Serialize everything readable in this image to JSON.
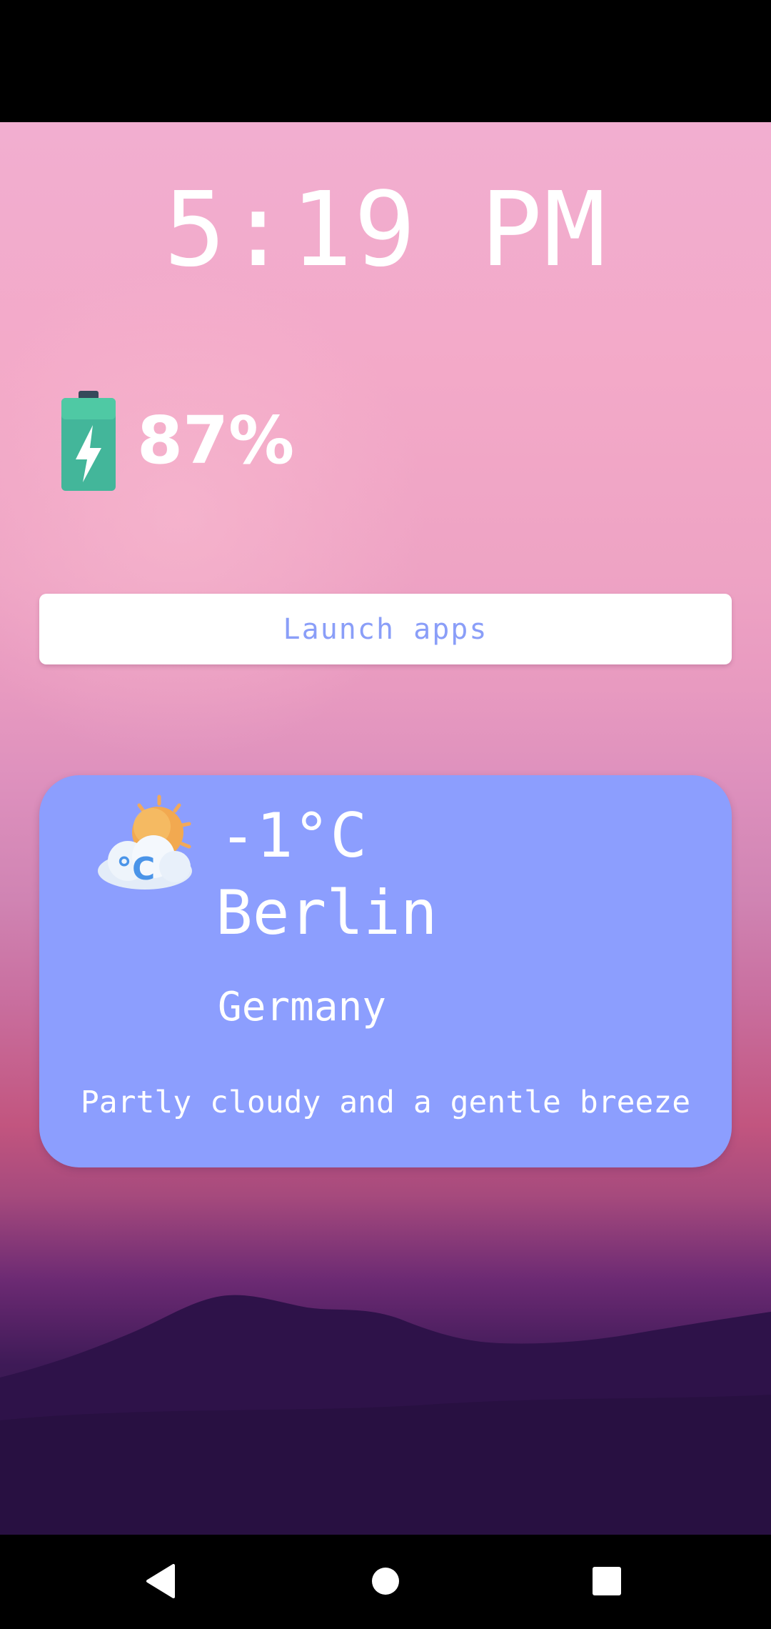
{
  "lockscreen": {
    "time": "5:19 PM",
    "battery": {
      "percent_label": "87%",
      "level": 0.87,
      "charging": true,
      "icon": "battery-charging-icon",
      "color": "#43b69a"
    },
    "launch_button": {
      "label": "Launch apps",
      "text_color": "#8a9ef8"
    },
    "weather": {
      "icon": "partly-cloudy-celsius-icon",
      "temperature": "-1°C",
      "city": "Berlin",
      "country": "Germany",
      "description": "Partly cloudy and a gentle breeze",
      "card_color": "#8c9efe"
    }
  },
  "nav_bar": {
    "back_icon": "back-triangle-icon",
    "home_icon": "home-circle-icon",
    "recents_icon": "recents-square-icon"
  }
}
